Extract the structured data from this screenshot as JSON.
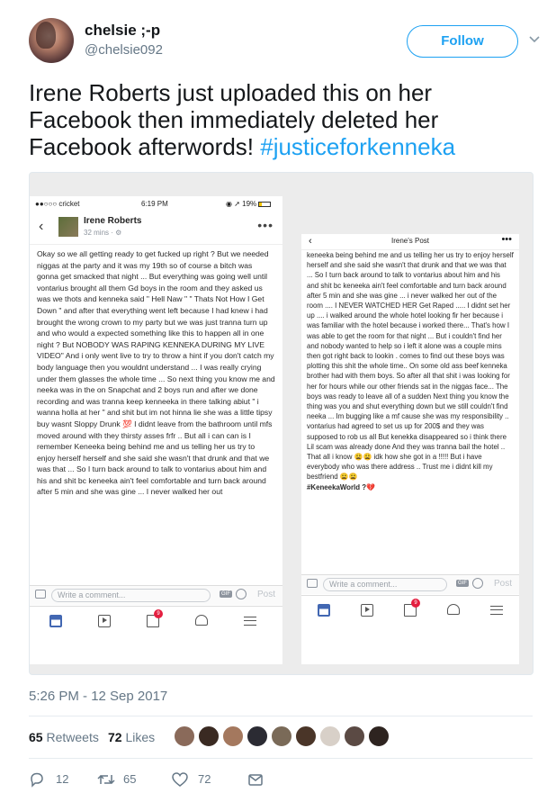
{
  "tweet": {
    "display_name": "chelsie ;-p",
    "handle": "@chelsie092",
    "follow_label": "Follow",
    "text": "Irene Roberts just uploaded this on her Facebook then immediately deleted her Facebook afterwords! ",
    "hashtag": "#justiceforkenneka",
    "timestamp": "5:26 PM - 12 Sep 2017",
    "retweets_count": "65",
    "retweets_label": "Retweets",
    "likes_count": "72",
    "likes_label": "Likes",
    "actions": {
      "reply": "12",
      "retweet": "65",
      "like": "72"
    }
  },
  "screenshot1": {
    "carrier": "●●○○○ cricket",
    "time": "6:19 PM",
    "battery": "19%",
    "author": "Irene Roberts",
    "post_time": "32 mins · ",
    "body": "Okay so we all getting ready to get fucked up right ? But we needed niggas at the party and it was my 19th so of course a bitch was gonna get smacked that night ... But everything was going well until vontarius brought all them Gd boys in the room and they asked us was we thots and kenneka said \" Hell Naw \" \" Thats Not How I Get Down \" and after that everything went left because I had knew i had brought the wrong crown to my party but we was just tranna turn up and who would a expected something like this to happen all in one night ? But NOBODY WAS RAPING KENNEKA DURING MY LIVE VIDEO\" And i only went live to try to throw a hint if you don't catch my body language then you wouldnt understand ... I was really crying under them glasses the whole time ... So next thing you know me and neeka was in the on Snapchat and 2 boys run and after we done recording and was tranna keep kenneeka in there talking abiut \" i wanna holla at her \" and shit but im not hinna lie she was a little tipsy buy wasnt Sloppy Drunk 💯 I didnt leave from the bathroom until mfs moved around  with they thirsty asses frfr .. But all i can can is I remember Keneeka being behind me and us telling her us try to enjoy herself herself and she said she wasn't that drunk and that we was that ... So I turn back around to talk to vontarius about him and his  and shit bc keneeka ain't feel comfortable and turn back around after 5 min and she was gine ... I never walked her out",
    "comment_placeholder": "Write a comment...",
    "post_label": "Post",
    "gif_label": "GIF",
    "badge": "9"
  },
  "screenshot2": {
    "title": "Irene's Post",
    "body": "keneeka being behind me and us telling her us try to enjoy herself herself and she said she wasn't that drunk and that we was that ... So I turn back around to talk to vontarius about him and his  and shit bc keneeka ain't feel comfortable and turn back around after 5 min and she was gine ... i never walked her out of the room .... I NEVER WATCHED HER Get Raped ..... I didnt set her up .... i walked around  the whole hotel looking fir her because i was familiar with the hotel because i worked there... That's how I was able to get the room for that night ... But i couldn't find her and nobody wanted to help so i left it alone was a couple mins then got right back to lookin . comes to find out these boys was plotting this shit the whole time.. On some old ass beef kenneka brother had with them boys. So after all that shit i was looking for her for hours while our other friends sat in the niggas face... The boys was ready to leave all of a sudden Next thing you know the thing was you and shut everything down but we still couldn't find neeka ... Im bugging like a mf cause she was my responsibility .. vontarius had agreed to set us up for 200$ and they was supposed to rob us all But kenekka disappeared so i think there Lil scam was already done And they was tranna bail the hotel .. That all i know 😩😩 idk how she got in a !!!!! But i have everybody who was there address .. Trust me i didnt kill my bestfriend 😩😩",
    "hashtag": "#KeneekaWorld ?",
    "heart": "💔",
    "comment_placeholder": "Write a comment...",
    "post_label": "Post",
    "gif_label": "GIF",
    "badge": "9"
  }
}
